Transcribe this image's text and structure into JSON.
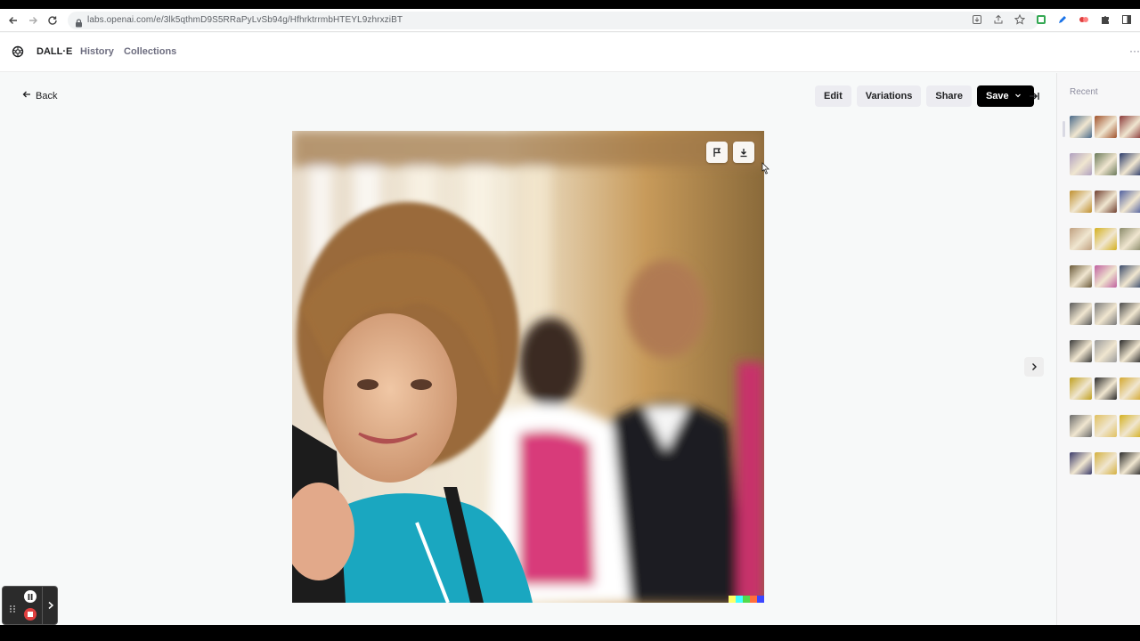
{
  "browser": {
    "url": "labs.openai.com/e/3lk5qthmD9S5RRaPyLvSb94g/HfhrktrrmbHTEYL9zhrxziBT"
  },
  "app": {
    "brand": "DALL·E",
    "nav": [
      "History",
      "Collections"
    ]
  },
  "toolbar": {
    "back_label": "Back",
    "edit_label": "Edit",
    "variations_label": "Variations",
    "share_label": "Share",
    "save_label": "Save"
  },
  "sidebar": {
    "title": "Recent",
    "thumb_colors": [
      "#4a6a8a",
      "#a0522d",
      "#8b3a3a",
      "#b0a0c0",
      "#6b7a5a",
      "#2a3a6a",
      "#c09030",
      "#704030",
      "#5060a0",
      "#c0a080",
      "#d4b020",
      "#8a8a6a",
      "#6a5a3a",
      "#c060a0",
      "#3a4a6a",
      "#5a5a5a",
      "#7a7a7a",
      "#4a4a4a",
      "#3a3a3a",
      "#9a9a9a",
      "#2a2a2a",
      "#c0a020",
      "#2a2a2a",
      "#d4a830",
      "#6a6a6a",
      "#e0c060",
      "#d4b020",
      "#3a3a6a",
      "#d4b040",
      "#2a2a2a"
    ]
  },
  "colors": {
    "primary_button": "#000000",
    "watermark": [
      "#ffff66",
      "#42ffff",
      "#51da4c",
      "#ff6e3c",
      "#3c46ff"
    ]
  }
}
